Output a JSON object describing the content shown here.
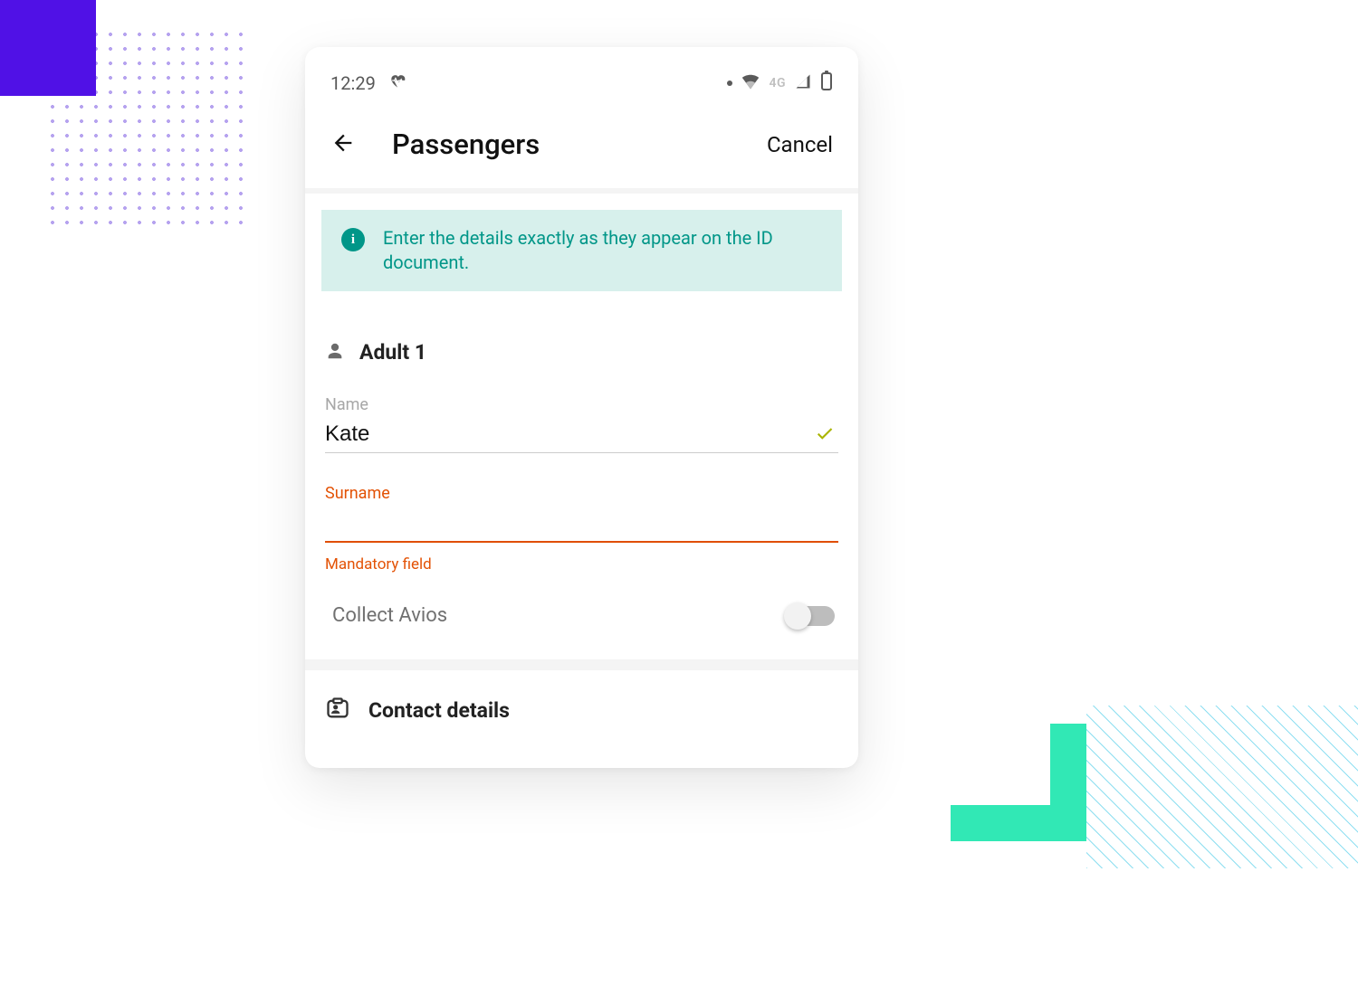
{
  "statusBar": {
    "time": "12:29",
    "network": "4G"
  },
  "nav": {
    "title": "Passengers",
    "cancel": "Cancel"
  },
  "banner": {
    "text": "Enter the details exactly as they appear on the ID document."
  },
  "passenger": {
    "section": "Adult 1",
    "name": {
      "label": "Name",
      "value": "Kate"
    },
    "surname": {
      "label": "Surname",
      "value": "",
      "helper": "Mandatory field"
    },
    "avios": {
      "label": "Collect Avios"
    }
  },
  "contact": {
    "title": "Contact details"
  }
}
